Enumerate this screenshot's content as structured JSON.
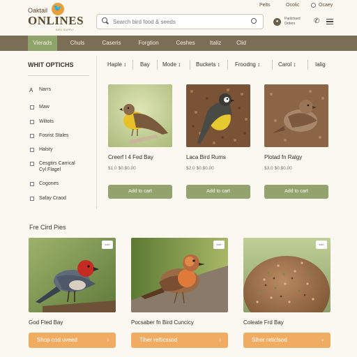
{
  "brand": {
    "top": "Oaktail",
    "badge": "🐦",
    "name": "ONLINES",
    "sub": "BIRD SUPPLY"
  },
  "header": {
    "search_placeholder": "Search bird food & seeds",
    "top_links": [
      "Pelts",
      "Ocolic",
      "Ocaey"
    ],
    "account_line1": "Parilchard",
    "account_line2": "Orders"
  },
  "nav": {
    "items": [
      "Vierads",
      "Chuls",
      "Caseris",
      "Forgtion",
      "Ceshes",
      "Italiz",
      "Clid"
    ]
  },
  "sidebar": {
    "title": "WHIT OPTICHS",
    "items": [
      {
        "label": "Narrs",
        "checked": true
      },
      {
        "label": "Maw",
        "checked": false
      },
      {
        "label": "Wiltots",
        "checked": false
      },
      {
        "label": "Fosrist Stales",
        "checked": false
      },
      {
        "label": "Halsty",
        "checked": false
      },
      {
        "label": "Cesgtirs Carrical",
        "label2": "Cyl Flagel",
        "checked": false
      },
      {
        "label": "Cogones",
        "checked": false
      },
      {
        "label": "Safay Craod",
        "checked": false
      }
    ]
  },
  "sort": {
    "items": [
      "Haple ↕",
      "Bay",
      "Mode ↕",
      "Buckets ↕",
      "Froodng ↕",
      "Carol ↕",
      "Ialig"
    ]
  },
  "products": [
    {
      "name": "Creerf l 4 Fed Bay",
      "price": "$1.0 $0.$0.00",
      "button": "Add to cart"
    },
    {
      "name": "Laca Bird Rums",
      "price": "$2.0 $0.$0.00",
      "button": "Add to cart"
    },
    {
      "name": "Plotad fn Ralgy",
      "price": "$3.0 $0.$0.00",
      "button": "Add to cart"
    }
  ],
  "featured": {
    "title": "Fre Cird Pies",
    "items": [
      {
        "name": "God Fted Bay",
        "button": "Shop cod uveed",
        "badge": "sale"
      },
      {
        "name": "Pocsaber fn Bird Cuncicy",
        "button": "Tiher refticssod",
        "badge": "sale"
      },
      {
        "name": "Coleate Frd Bay",
        "button": "Siher reticlsod",
        "badge": "sale"
      }
    ]
  },
  "colors": {
    "nav": "#7b6e57",
    "accent_green": "#94a36e",
    "accent_orange": "#efac62",
    "background": "#fbf8f1"
  }
}
